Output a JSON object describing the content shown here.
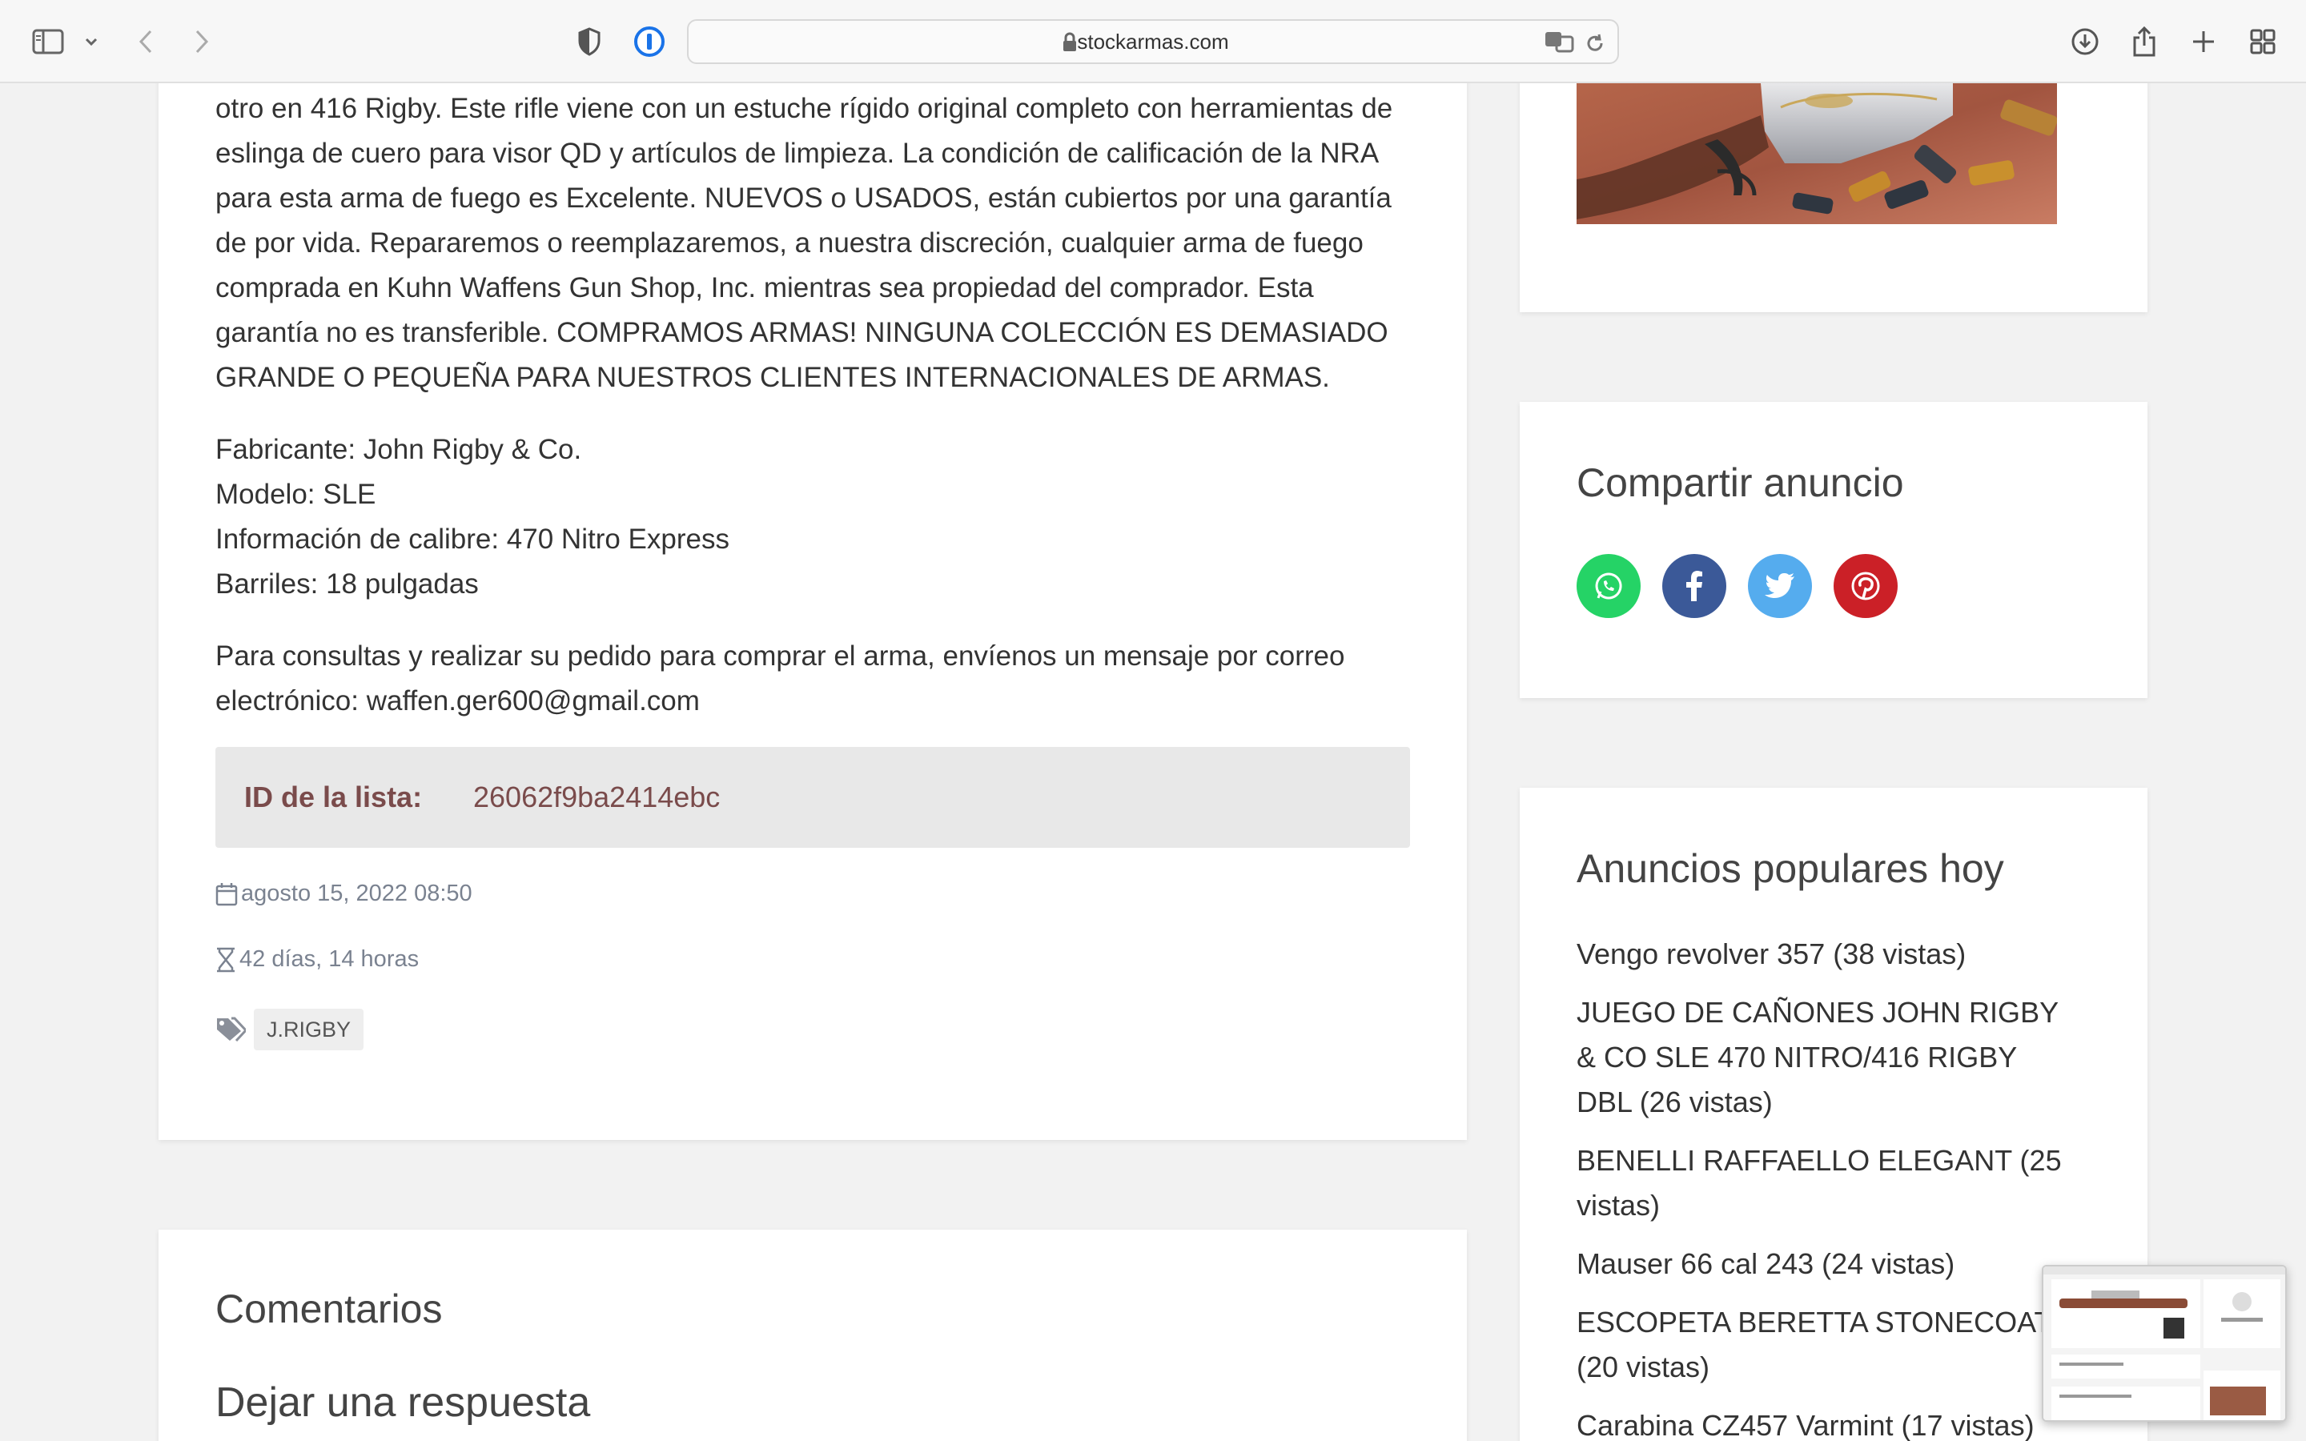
{
  "browser": {
    "url": "stockarmas.com"
  },
  "article": {
    "paragraph_1": "otro en 416 Rigby. Este rifle viene con un estuche rígido original completo con herramientas de eslinga de cuero para visor QD y artículos de limpieza. La condición de calificación de la NRA para esta arma de fuego es Excelente. NUEVOS o USADOS, están cubiertos por una garantía de por vida. Repararemos o reemplazaremos, a nuestra discreción, cualquier arma de fuego comprada en Kuhn Waffens Gun Shop, Inc. mientras sea propiedad del comprador. Esta garantía no es transferible. COMPRAMOS ARMAS! NINGUNA COLECCIÓN ES DEMASIADO GRANDE O PEQUEÑA PARA NUESTROS CLIENTES INTERNACIONALES DE ARMAS.",
    "specs": [
      "Fabricante: John Rigby & Co.",
      "Modelo: SLE",
      "Información de calibre: 470 Nitro Express",
      "Barriles: 18 pulgadas"
    ],
    "contact": "Para consultas y realizar su pedido para comprar el arma, envíenos un mensaje por correo electrónico: waffen.ger600@gmail.com",
    "listing_id_label": "ID de la lista:",
    "listing_id_value": "26062f9ba2414ebc",
    "date": "agosto 15, 2022 08:50",
    "remaining": "42 días, 14 horas",
    "tags": [
      "J.RIGBY"
    ]
  },
  "comments": {
    "title": "Comentarios",
    "reply_title": "Dejar una respuesta"
  },
  "sidebar": {
    "share_title": "Compartir anuncio",
    "social": [
      {
        "name": "whatsapp",
        "color": "#25d366"
      },
      {
        "name": "facebook",
        "color": "#3b5998"
      },
      {
        "name": "twitter",
        "color": "#55acee"
      },
      {
        "name": "pinterest",
        "color": "#cb2027"
      }
    ],
    "popular_title": "Anuncios populares hoy",
    "popular": [
      "Vengo revolver 357 (38 vistas)",
      "JUEGO DE CAÑONES JOHN RIGBY & CO SLE 470 NITRO/416 RIGBY DBL (26 vistas)",
      "BENELLI RAFFAELLO ELEGANT (25 vistas)",
      "Mauser 66 cal 243 (24 vistas)",
      "ESCOPETA BERETTA STONECOAT (20 vistas)",
      "Carabina CZ457 Varmint (17 vistas)"
    ]
  }
}
